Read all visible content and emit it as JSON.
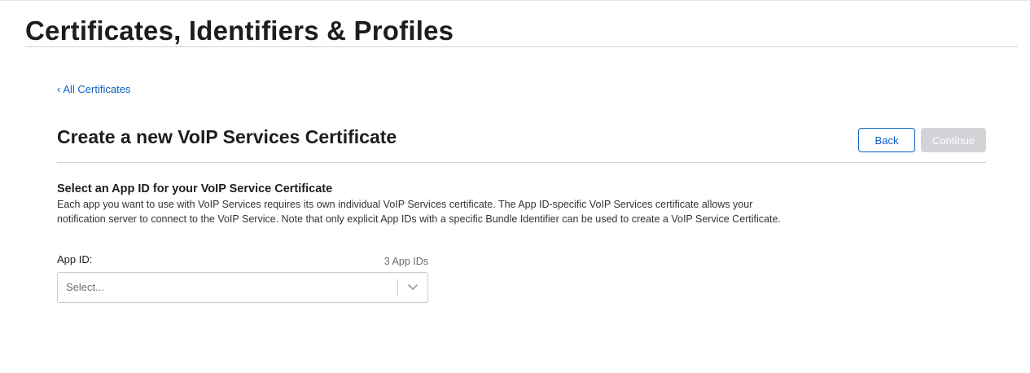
{
  "header": {
    "title": "Certificates, Identifiers & Profiles"
  },
  "breadcrumb": {
    "back_label": "All Certificates"
  },
  "page": {
    "title": "Create a new VoIP Services Certificate"
  },
  "buttons": {
    "back_label": "Back",
    "continue_label": "Continue"
  },
  "section": {
    "title": "Select an App ID for your VoIP Service Certificate",
    "description": "Each app you want to use with VoIP Services requires its own individual VoIP Services certificate. The App ID-specific VoIP Services certificate allows your notification server to connect to the VoIP Service. Note that only explicit App IDs with a specific Bundle Identifier can be used to create a VoIP Service Certificate."
  },
  "app_id_field": {
    "label": "App ID:",
    "count": "3 App IDs",
    "placeholder": "Select..."
  },
  "colors": {
    "link": "#0a5fc5",
    "disabled_button": "#d2d2d7",
    "divider": "#d2d2d7"
  },
  "icons": {
    "back_chevron": "chevron-left-icon",
    "select_chevron": "chevron-down-icon"
  }
}
